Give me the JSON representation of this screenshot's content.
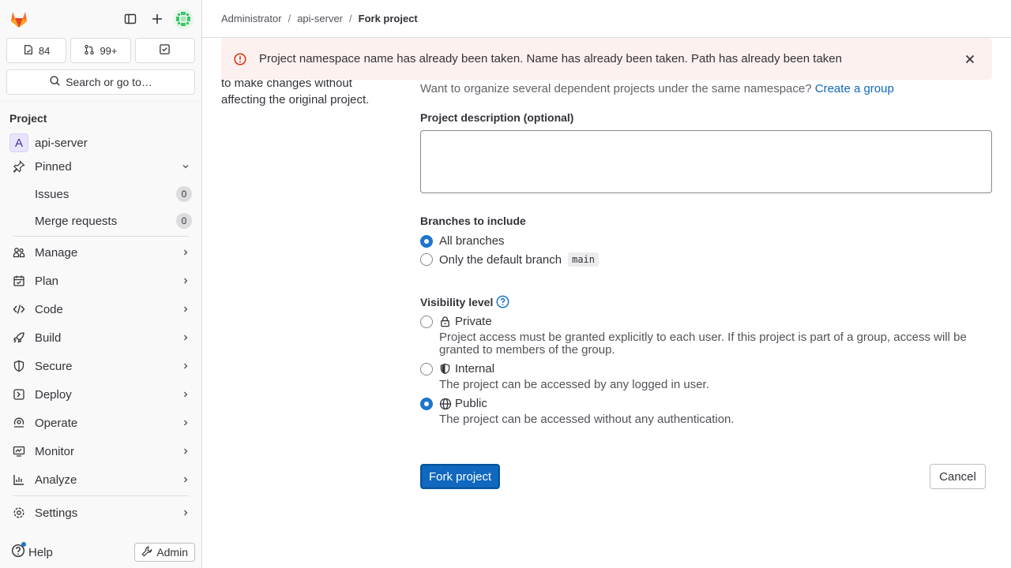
{
  "sidebar": {
    "counters": {
      "issues": "84",
      "merge_requests": "99+"
    },
    "search_label": "Search or go to…",
    "section_title": "Project",
    "project": {
      "initial": "A",
      "name": "api-server"
    },
    "pinned": {
      "label": "Pinned",
      "items": [
        {
          "label": "Issues",
          "count": "0"
        },
        {
          "label": "Merge requests",
          "count": "0"
        }
      ]
    },
    "nav": [
      {
        "label": "Manage",
        "icon": "users-icon"
      },
      {
        "label": "Plan",
        "icon": "plan-icon"
      },
      {
        "label": "Code",
        "icon": "code-icon"
      },
      {
        "label": "Build",
        "icon": "rocket-icon"
      },
      {
        "label": "Secure",
        "icon": "shield-icon"
      },
      {
        "label": "Deploy",
        "icon": "deploy-icon"
      },
      {
        "label": "Operate",
        "icon": "operate-icon"
      },
      {
        "label": "Monitor",
        "icon": "monitor-icon"
      },
      {
        "label": "Analyze",
        "icon": "chart-icon"
      }
    ],
    "settings_label": "Settings",
    "help_label": "Help",
    "admin_label": "Admin"
  },
  "breadcrumb": [
    "Administrator",
    "api-server",
    "Fork project"
  ],
  "alert": {
    "message": "Project namespace name has already been taken. Name has already been taken. Path has already been taken"
  },
  "left_description": "to make changes without affecting the original project.",
  "form": {
    "group_help": "Want to organize several dependent projects under the same namespace?",
    "group_link": "Create a group",
    "description_label": "Project description (optional)",
    "description_value": "",
    "branches_label": "Branches to include",
    "branch_options": [
      {
        "label": "All branches",
        "checked": true
      },
      {
        "label": "Only the default branch",
        "code": "main",
        "checked": false
      }
    ],
    "visibility_label": "Visibility level",
    "visibility_options": [
      {
        "label": "Private",
        "icon": "lock-icon",
        "checked": false,
        "description": "Project access must be granted explicitly to each user. If this project is part of a group, access will be granted to members of the group."
      },
      {
        "label": "Internal",
        "icon": "shield-half-icon",
        "checked": false,
        "description": "The project can be accessed by any logged in user."
      },
      {
        "label": "Public",
        "icon": "globe-icon",
        "checked": true,
        "description": "The project can be accessed without any authentication."
      }
    ],
    "submit_label": "Fork project",
    "cancel_label": "Cancel"
  },
  "colors": {
    "primary": "#1f75cb",
    "link": "#1068bf",
    "alert_bg": "#fcf1ef",
    "danger": "#dd2b0e"
  }
}
